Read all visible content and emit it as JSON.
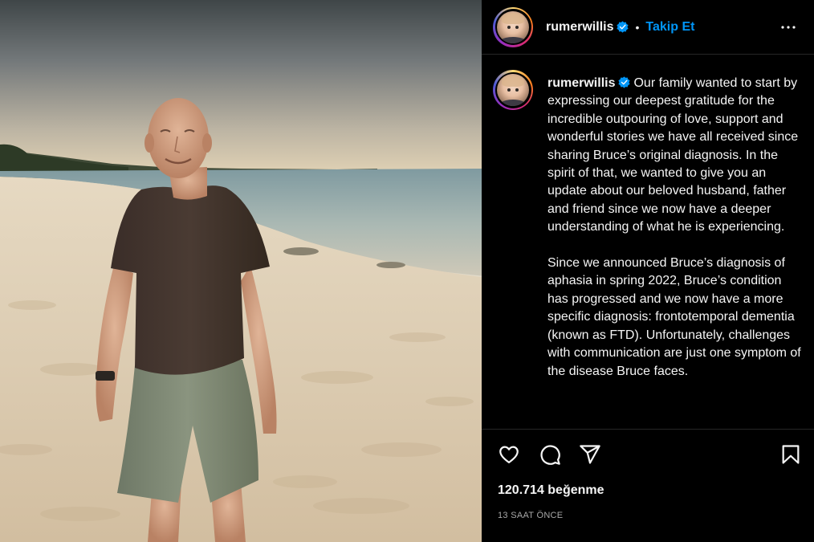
{
  "post": {
    "image_alt": "Man in brown t-shirt and grey shorts standing on a sandy beach by the sea",
    "author": {
      "username": "rumerwillis",
      "verified_icon": "verified-badge-icon"
    },
    "header": {
      "dot": "•",
      "follow_label": "Takip Et",
      "more_icon": "more-options-icon"
    },
    "caption": {
      "username": "rumerwillis",
      "text": "Our family wanted to start by expressing our deepest gratitude for the incredible outpouring of love, support and wonderful stories we have all received since sharing Bruce’s original diagnosis. In the spirit of that, we wanted to give you an update about our beloved husband, father and friend since we now have a deeper understanding of what he is experiencing.\n\nSince we announced Bruce’s diagnosis of aphasia in spring 2022, Bruce’s condition has progressed and we now have a more specific diagnosis: frontotemporal dementia (known as FTD). Unfortunately, challenges with communication are just one symptom of the disease Bruce faces."
    },
    "actions": {
      "like_icon": "heart-icon",
      "comment_icon": "comment-icon",
      "share_icon": "share-icon",
      "save_icon": "bookmark-icon"
    },
    "likes_text": "120.714 beğenme",
    "time_text": "13 SAAT ÖNCE",
    "colors": {
      "background": "#000000",
      "text": "#f5f5f5",
      "follow": "#0095f6",
      "verified": "#0095f6",
      "muted": "#a8a8a8"
    }
  }
}
